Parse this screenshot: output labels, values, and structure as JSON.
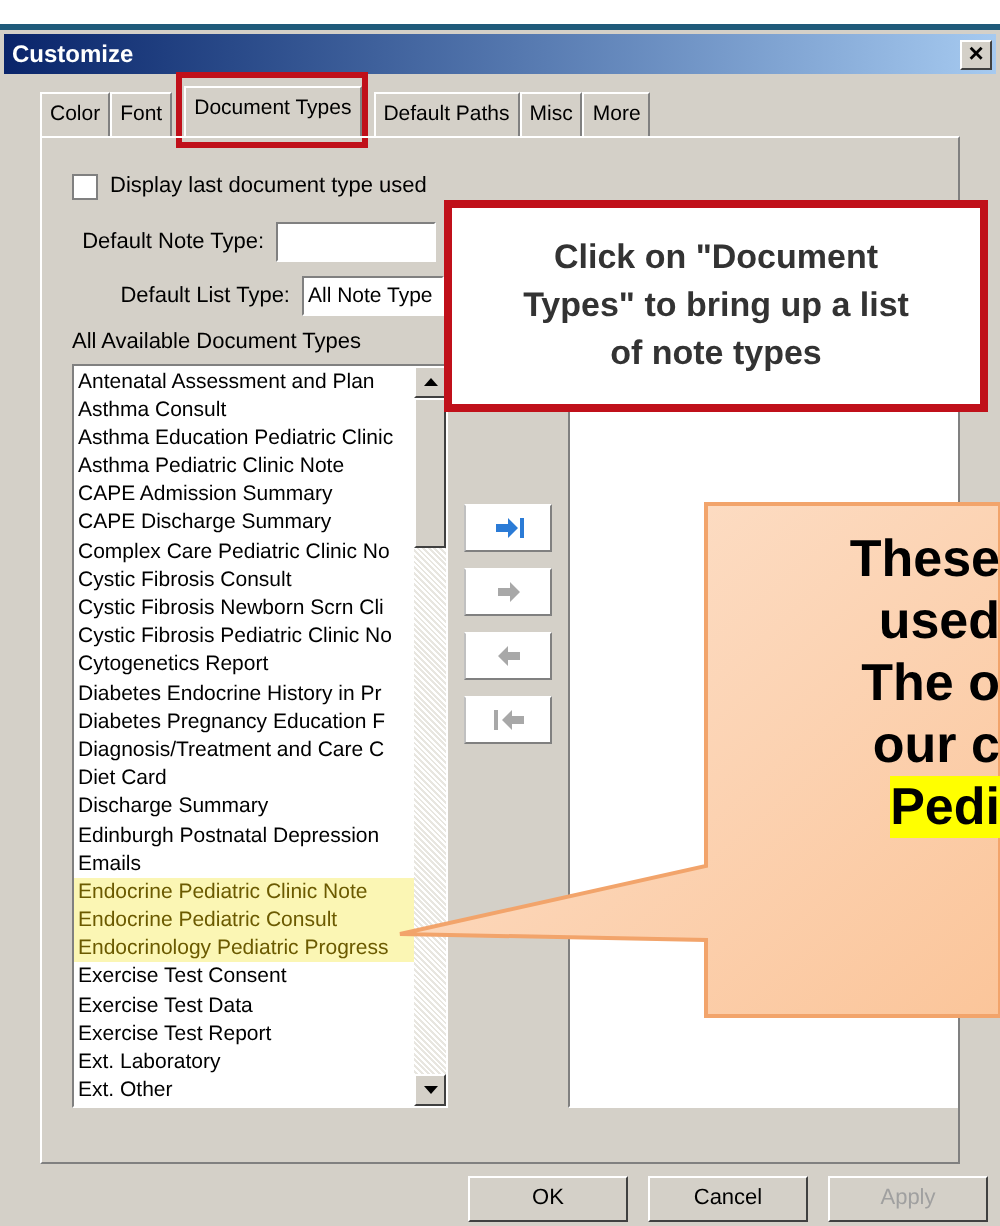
{
  "window": {
    "title": "Customize",
    "close": "×"
  },
  "tabs": [
    {
      "label": "Color",
      "selected": false
    },
    {
      "label": "Font",
      "selected": false
    },
    {
      "label": "Document Types",
      "selected": true
    },
    {
      "label": "Default Paths",
      "selected": false
    },
    {
      "label": "Misc",
      "selected": false
    },
    {
      "label": "More",
      "selected": false
    }
  ],
  "display_last": {
    "label": "Display last document type used",
    "checked": false
  },
  "default_note_type": {
    "label": "Default Note Type:"
  },
  "default_list_type": {
    "label": "Default List Type:",
    "value": "All Note Type"
  },
  "available_label": "All Available Document Types",
  "available": [
    {
      "text": "Antenatal Assessment and Plan",
      "highlighted": false
    },
    {
      "text": "Asthma Consult",
      "highlighted": false
    },
    {
      "text": "Asthma Education Pediatric Clinic",
      "highlighted": false
    },
    {
      "text": "Asthma Pediatric Clinic Note",
      "highlighted": false
    },
    {
      "text": "CAPE Admission Summary",
      "highlighted": false
    },
    {
      "text": "CAPE Discharge Summary",
      "highlighted": false
    },
    {
      "text": "Complex Care Pediatric Clinic No",
      "highlighted": false
    },
    {
      "text": "Cystic Fibrosis Consult",
      "highlighted": false
    },
    {
      "text": "Cystic Fibrosis Newborn Scrn Cli",
      "highlighted": false
    },
    {
      "text": "Cystic Fibrosis Pediatric Clinic No",
      "highlighted": false
    },
    {
      "text": "Cytogenetics Report",
      "highlighted": false
    },
    {
      "text": "Diabetes Endocrine History in Pr",
      "highlighted": false
    },
    {
      "text": "Diabetes Pregnancy Education F",
      "highlighted": false
    },
    {
      "text": "Diagnosis/Treatment and Care C",
      "highlighted": false
    },
    {
      "text": "Diet Card",
      "highlighted": false
    },
    {
      "text": "Discharge Summary",
      "highlighted": false
    },
    {
      "text": "Edinburgh Postnatal Depression",
      "highlighted": false
    },
    {
      "text": "Emails",
      "highlighted": false
    },
    {
      "text": "Endocrine Pediatric Clinic Note",
      "highlighted": true
    },
    {
      "text": "Endocrine Pediatric Consult",
      "highlighted": true
    },
    {
      "text": "Endocrinology Pediatric Progress",
      "highlighted": true
    },
    {
      "text": "Exercise Test Consent",
      "highlighted": false
    },
    {
      "text": "Exercise Test Data",
      "highlighted": false
    },
    {
      "text": "Exercise Test Report",
      "highlighted": false
    },
    {
      "text": "Ext. Laboratory",
      "highlighted": false
    },
    {
      "text": "Ext. Other",
      "highlighted": false
    }
  ],
  "move_buttons": [
    {
      "kind": "add-all",
      "disabled": false
    },
    {
      "kind": "add",
      "disabled": true
    },
    {
      "kind": "remove",
      "disabled": true
    },
    {
      "kind": "remove-all",
      "disabled": true
    }
  ],
  "buttons": [
    {
      "label": "OK",
      "disabled": false
    },
    {
      "label": "Cancel",
      "disabled": false
    },
    {
      "label": "Apply",
      "disabled": true
    }
  ],
  "callout_top": {
    "text": "Click on \"Document Types\" to bring up a list of note types"
  },
  "callout_right": {
    "lines": [
      "These",
      "used",
      "The o",
      "our c",
      "**Pedi**"
    ],
    "highlight_last": true
  }
}
